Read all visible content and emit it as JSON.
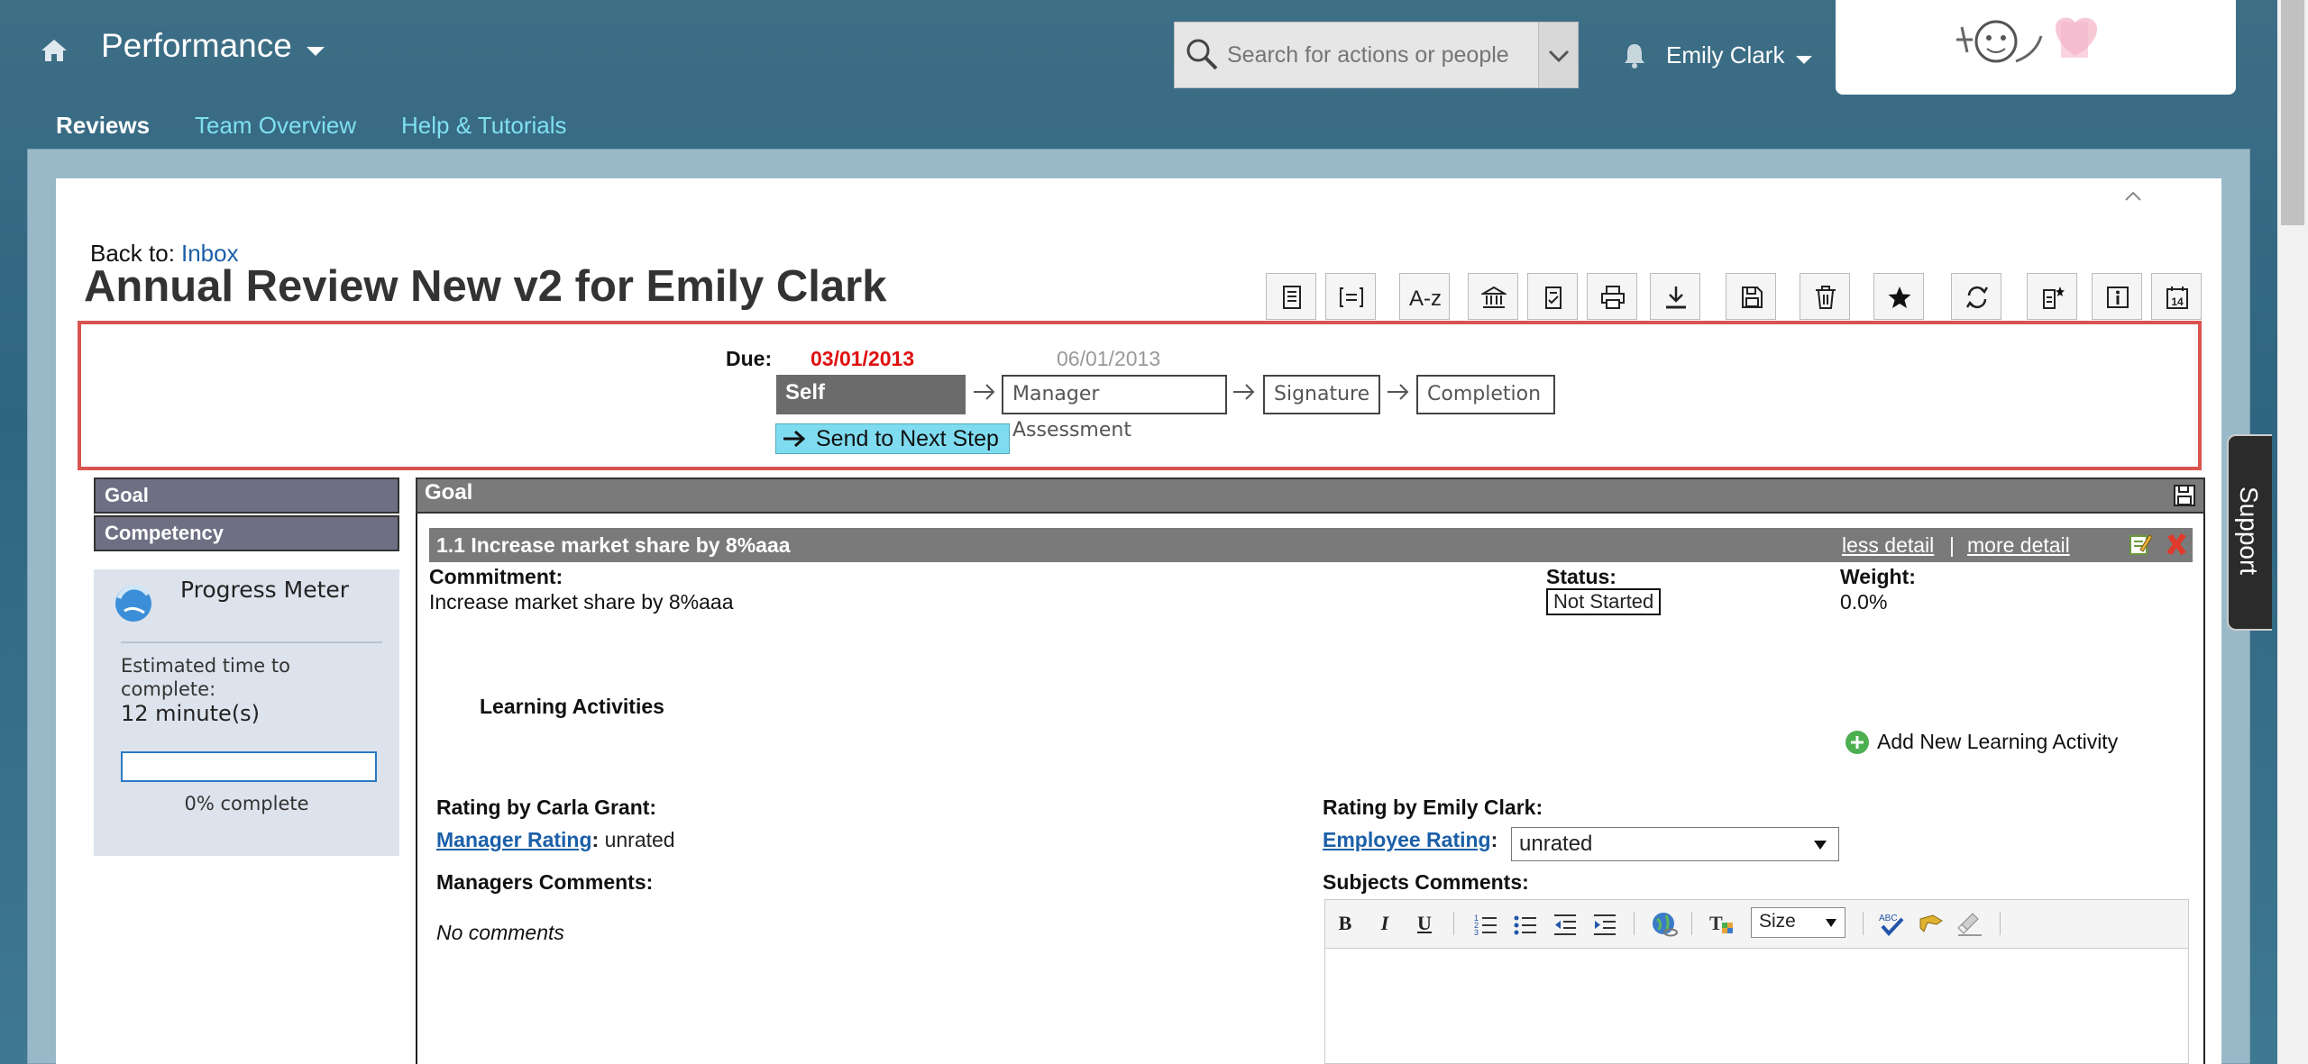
{
  "header": {
    "app_title": "Performance",
    "search": {
      "placeholder": "Search for actions or people",
      "value": ""
    },
    "user_name": "Emily Clark"
  },
  "nav": [
    {
      "label": "Reviews",
      "active": true
    },
    {
      "label": "Team Overview"
    },
    {
      "label": "Help & Tutorials"
    }
  ],
  "page": {
    "back_label": "Back to:",
    "back_link": "Inbox",
    "title": "Annual Review New v2 for Emily Clark"
  },
  "toolbar": {
    "sort_label": "A-z",
    "calendar_label": "14",
    "icons": [
      "document-icon",
      "bracket-list-icon",
      "sort-az-icon",
      "bank-icon",
      "checklist-icon",
      "print-icon",
      "download-icon",
      "save-icon",
      "trash-icon",
      "star-icon",
      "refresh-icon",
      "new-document-icon",
      "info-icon",
      "calendar-icon"
    ]
  },
  "workflow": {
    "due_label": "Due:",
    "due_date_current": "03/01/2013",
    "due_date_next": "06/01/2013",
    "steps": [
      "Self Assessment",
      "Manager Assessment",
      "Signature",
      "Completion"
    ],
    "active_step": "Self Assessment",
    "send_button": "Send to Next Step"
  },
  "sidebar": {
    "sections": [
      "Goal",
      "Competency"
    ],
    "progress": {
      "title": "Progress Meter",
      "estimate_label": "Estimated time to complete:",
      "estimate_value": "12 minute(s)",
      "percent": 0,
      "percent_label": "0% complete"
    }
  },
  "goal": {
    "section_title": "Goal",
    "item_title": "1.1 Increase market share by 8%aaa",
    "less_detail": "less detail",
    "separator": "|",
    "more_detail": "more detail",
    "commitment_label": "Commitment:",
    "commitment_value": "Increase market share by 8%aaa",
    "status_label": "Status:",
    "status_value": "Not Started",
    "weight_label": "Weight:",
    "weight_value": "0.0%",
    "learning_title": "Learning Activities",
    "add_learning": "Add New Learning Activity",
    "manager_rating_heading": "Rating by Carla Grant:",
    "manager_rating_link": "Manager Rating",
    "manager_rating_value": "unrated",
    "employee_rating_heading": "Rating by Emily Clark:",
    "employee_rating_link": "Employee Rating",
    "employee_rating_value": "unrated",
    "colon": ":",
    "manager_comments_label": "Managers Comments:",
    "manager_comments_value": "No comments",
    "subject_comments_label": "Subjects Comments:",
    "editor_size_label": "Size"
  },
  "support_label": "Support",
  "colors": {
    "accent": "#7fdcf0",
    "due_highlight": "#e01010",
    "workflow_border": "#d9534f",
    "progress": "#2a78c2"
  }
}
